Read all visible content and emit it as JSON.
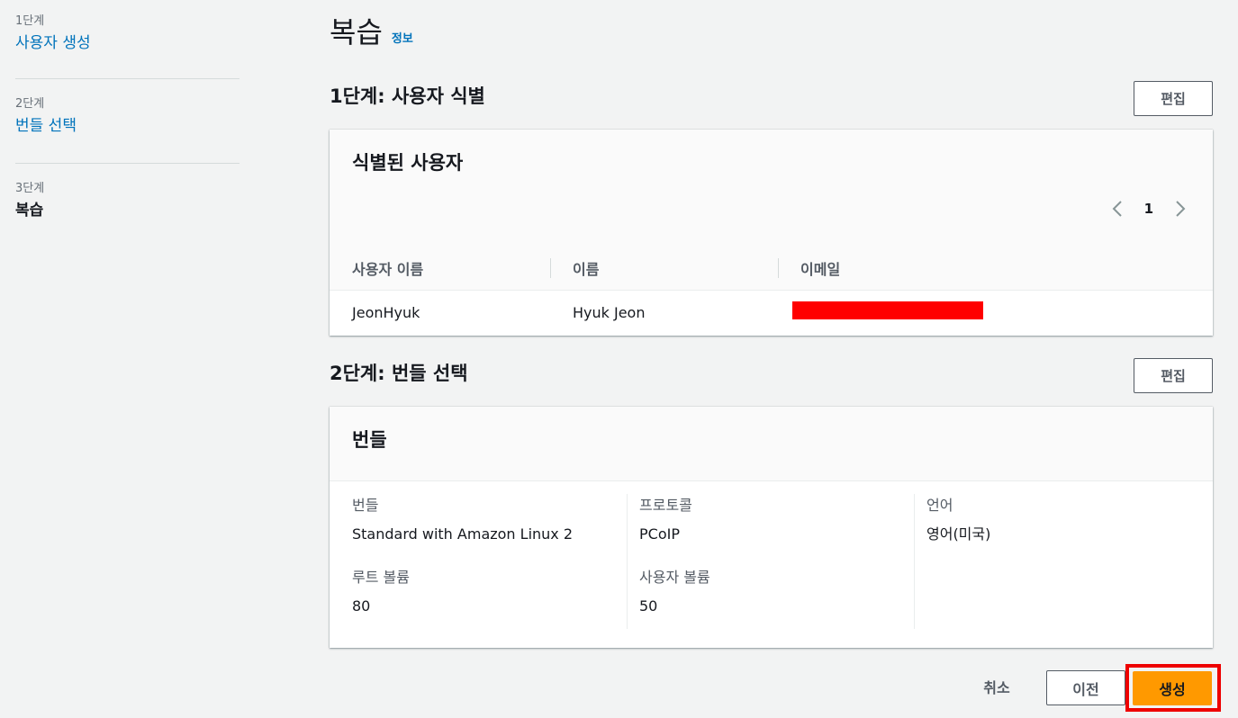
{
  "sidebar": {
    "steps": [
      {
        "num": "1단계",
        "label": "사용자 생성"
      },
      {
        "num": "2단계",
        "label": "번들 선택"
      },
      {
        "num": "3단계",
        "label": "복습"
      }
    ]
  },
  "page": {
    "title": "복습",
    "info": "정보"
  },
  "section1": {
    "title": "1단계: 사용자 식별",
    "edit": "편집",
    "card_title": "식별된 사용자",
    "pager": {
      "current": "1"
    },
    "columns": [
      "사용자 이름",
      "이름",
      "이메일"
    ],
    "rows": [
      {
        "username": "JeonHyuk",
        "name": "Hyuk Jeon",
        "email": ""
      }
    ]
  },
  "section2": {
    "title": "2단계: 번들 선택",
    "edit": "편집",
    "card_title": "번들",
    "fields": {
      "bundle": {
        "label": "번들",
        "value": "Standard with Amazon Linux 2"
      },
      "root_volume": {
        "label": "루트 볼륨",
        "value": "80"
      },
      "protocol": {
        "label": "프로토콜",
        "value": "PCoIP"
      },
      "user_volume": {
        "label": "사용자 볼륨",
        "value": "50"
      },
      "language": {
        "label": "언어",
        "value": "영어(미국)"
      }
    }
  },
  "footer": {
    "cancel": "취소",
    "prev": "이전",
    "create": "생성"
  },
  "colors": {
    "accent": "#0073bb",
    "primary": "#ff9900",
    "highlight": "#ee0000",
    "redaction": "#ff0000"
  }
}
